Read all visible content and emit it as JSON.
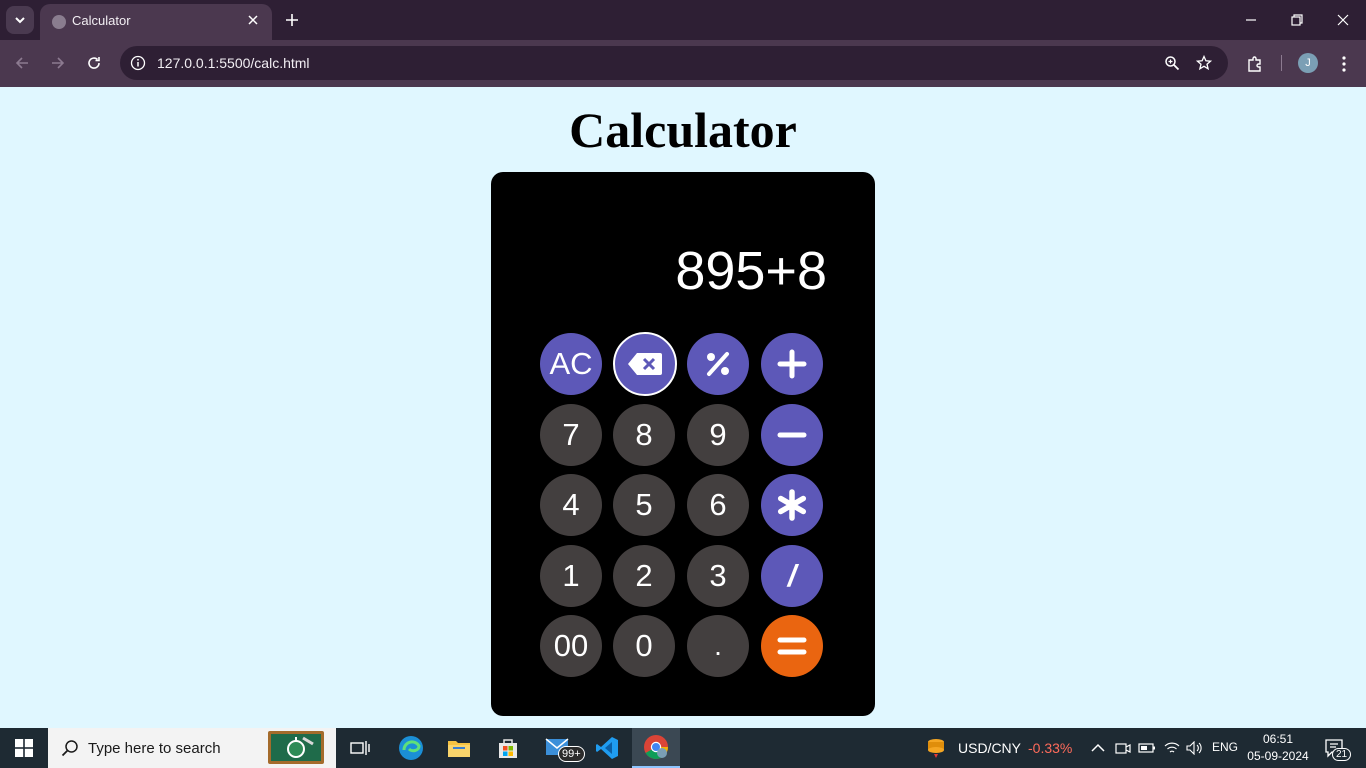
{
  "browser": {
    "tab_title": "Calculator",
    "url": "127.0.0.1:5500/calc.html",
    "profile_initial": "J"
  },
  "page": {
    "title": "Calculator"
  },
  "calculator": {
    "display": "895+8",
    "keys": [
      {
        "label": "AC",
        "name": "clear-button",
        "style": "purple"
      },
      {
        "label": "",
        "name": "backspace-button",
        "icon": "backspace-icon",
        "style": "purple-outline"
      },
      {
        "label": "",
        "name": "percent-button",
        "icon": "percent-icon",
        "style": "purple"
      },
      {
        "label": "",
        "name": "add-button",
        "icon": "plus-icon",
        "style": "purple"
      },
      {
        "label": "7",
        "name": "digit-7-button",
        "style": "grey"
      },
      {
        "label": "8",
        "name": "digit-8-button",
        "style": "grey"
      },
      {
        "label": "9",
        "name": "digit-9-button",
        "style": "grey"
      },
      {
        "label": "",
        "name": "subtract-button",
        "icon": "minus-icon",
        "style": "purple"
      },
      {
        "label": "4",
        "name": "digit-4-button",
        "style": "grey"
      },
      {
        "label": "5",
        "name": "digit-5-button",
        "style": "grey"
      },
      {
        "label": "6",
        "name": "digit-6-button",
        "style": "grey"
      },
      {
        "label": "",
        "name": "multiply-button",
        "icon": "asterisk-icon",
        "style": "purple"
      },
      {
        "label": "1",
        "name": "digit-1-button",
        "style": "grey"
      },
      {
        "label": "2",
        "name": "digit-2-button",
        "style": "grey"
      },
      {
        "label": "3",
        "name": "digit-3-button",
        "style": "grey"
      },
      {
        "label": "/",
        "name": "divide-button",
        "style": "purple"
      },
      {
        "label": "00",
        "name": "double-zero-button",
        "style": "grey"
      },
      {
        "label": "0",
        "name": "digit-0-button",
        "style": "grey"
      },
      {
        "label": ".",
        "name": "decimal-button",
        "style": "grey"
      },
      {
        "label": "",
        "name": "equals-button",
        "icon": "equals-icon",
        "style": "orange"
      }
    ]
  },
  "taskbar": {
    "search_placeholder": "Type here to search",
    "mail_badge": "99+",
    "ticker_name": "USD/CNY",
    "ticker_change": "-0.33%",
    "language": "ENG",
    "time": "06:51",
    "date": "05-09-2024",
    "notification_count": "21"
  },
  "colors": {
    "page_background": "#e0f7ff",
    "purple_key": "#5d58b8",
    "grey_key": "#433f3f",
    "orange_key": "#ea6510"
  }
}
